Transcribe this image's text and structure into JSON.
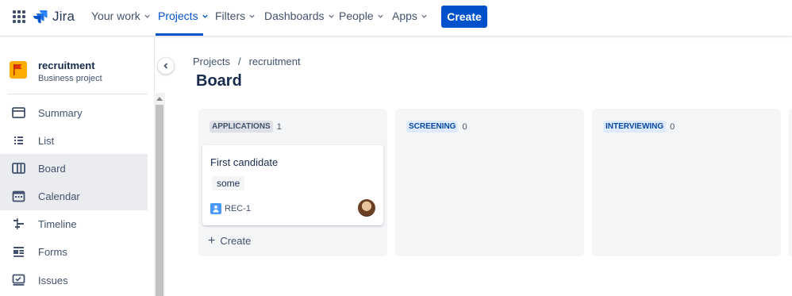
{
  "header": {
    "logo_text": "Jira",
    "nav": [
      {
        "label": "Your work"
      },
      {
        "label": "Projects"
      },
      {
        "label": "Filters"
      },
      {
        "label": "Dashboards"
      },
      {
        "label": "People"
      },
      {
        "label": "Apps"
      }
    ],
    "create_label": "Create"
  },
  "sidebar": {
    "project_name": "recruitment",
    "project_type": "Business project",
    "items": [
      {
        "label": "Summary",
        "icon": "summary-icon"
      },
      {
        "label": "List",
        "icon": "list-icon"
      },
      {
        "label": "Board",
        "icon": "board-icon"
      },
      {
        "label": "Calendar",
        "icon": "calendar-icon"
      },
      {
        "label": "Timeline",
        "icon": "timeline-icon"
      },
      {
        "label": "Forms",
        "icon": "forms-icon"
      },
      {
        "label": "Issues",
        "icon": "issues-icon"
      }
    ]
  },
  "breadcrumb": [
    "Projects",
    "/",
    "recruitment"
  ],
  "page_title": "Board",
  "board": {
    "columns": [
      {
        "name": "APPLICATIONS",
        "count": "1",
        "tag_bg": "#dfe1e6"
      },
      {
        "name": "SCREENING",
        "count": "0",
        "tag_bg": "#deebff"
      },
      {
        "name": "INTERVIEWING",
        "count": "0",
        "tag_bg": "#deebff"
      }
    ],
    "card": {
      "title": "First candidate",
      "label": "some",
      "key": "REC-1"
    },
    "create_label": "Create"
  },
  "colors": {
    "accent": "#0052cc",
    "project_avatar": "#ffab00"
  }
}
